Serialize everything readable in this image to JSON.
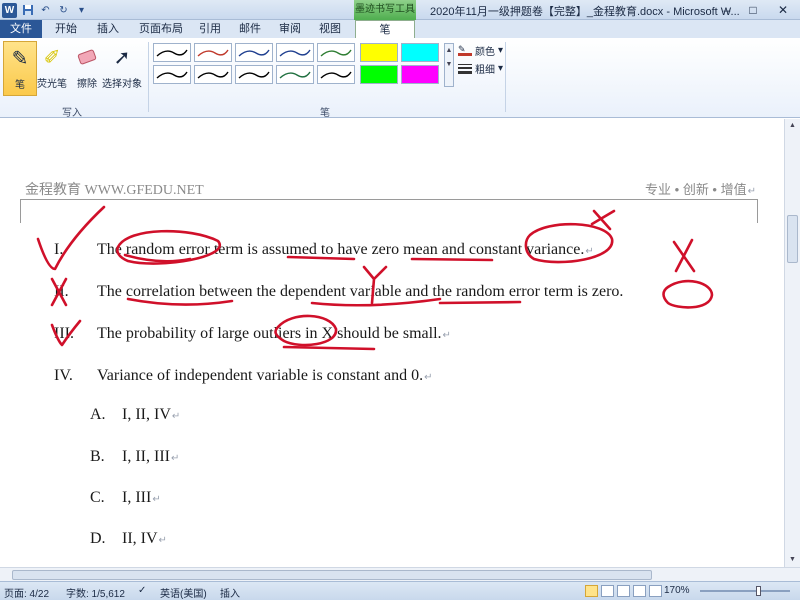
{
  "window": {
    "title": "2020年11月一级押题卷【完整】_金程教育.docx - Microsoft W...",
    "contextual_tab_title": "墨迹书写工具",
    "controls": [
      "–",
      "□",
      "✕"
    ]
  },
  "quick_access": {
    "icons": [
      "word-icon",
      "save-icon",
      "undo-icon",
      "redo-icon",
      "customize-icon"
    ]
  },
  "tabs": [
    {
      "label": "文件"
    },
    {
      "label": "开始"
    },
    {
      "label": "插入"
    },
    {
      "label": "页面布局"
    },
    {
      "label": "引用"
    },
    {
      "label": "邮件"
    },
    {
      "label": "审阅"
    },
    {
      "label": "视图"
    },
    {
      "label": "笔"
    }
  ],
  "ribbon": {
    "write_group": {
      "label": "写入",
      "tools": [
        {
          "label": "笔",
          "icon": "pen-icon",
          "selected": true
        },
        {
          "label": "荧光笔",
          "icon": "highlighter-icon",
          "selected": false
        },
        {
          "label": "擦除",
          "icon": "eraser-icon",
          "selected": false
        },
        {
          "label": "选择对象",
          "icon": "select-cursor-icon",
          "selected": false
        }
      ]
    },
    "pens_group": {
      "label": "笔",
      "pen_colors": [
        "#000000",
        "#c0392b",
        "#1f3f8f",
        "#1f3f8f",
        "#2e7d32",
        "#000000",
        "#000000",
        "#000000",
        "#1f6f3f",
        "#000000"
      ],
      "highlighter_colors": [
        "#ffff00",
        "#00ffff",
        "#00ff00",
        "#ff00ff"
      ],
      "color_label": "颜色",
      "thickness_label": "粗细"
    }
  },
  "document": {
    "header_brand": "金程教育 WWW.GFEDU.NET",
    "header_slogan": "专业 • 创新 • 增值",
    "statements": [
      {
        "num": "I.",
        "text": "The random error term is assumed to have zero mean and constant variance."
      },
      {
        "num": "II.",
        "text": "The correlation between the dependent variable and the random error term is zero."
      },
      {
        "num": "III.",
        "text": "The probability of large outliers in X should be small."
      },
      {
        "num": "IV.",
        "text": "Variance of independent variable is constant and 0."
      }
    ],
    "options": [
      {
        "letter": "A.",
        "value": "I, II, IV"
      },
      {
        "letter": "B.",
        "value": "I, II, III"
      },
      {
        "letter": "C.",
        "value": "I, III"
      },
      {
        "letter": "D.",
        "value": "II, IV"
      }
    ],
    "ink_color": "#d0102a"
  },
  "status_bar": {
    "page": "页面: 4/22",
    "words": "字数: 1/5,612",
    "language": "英语(美国)",
    "mode": "插入",
    "zoom": "170%"
  }
}
